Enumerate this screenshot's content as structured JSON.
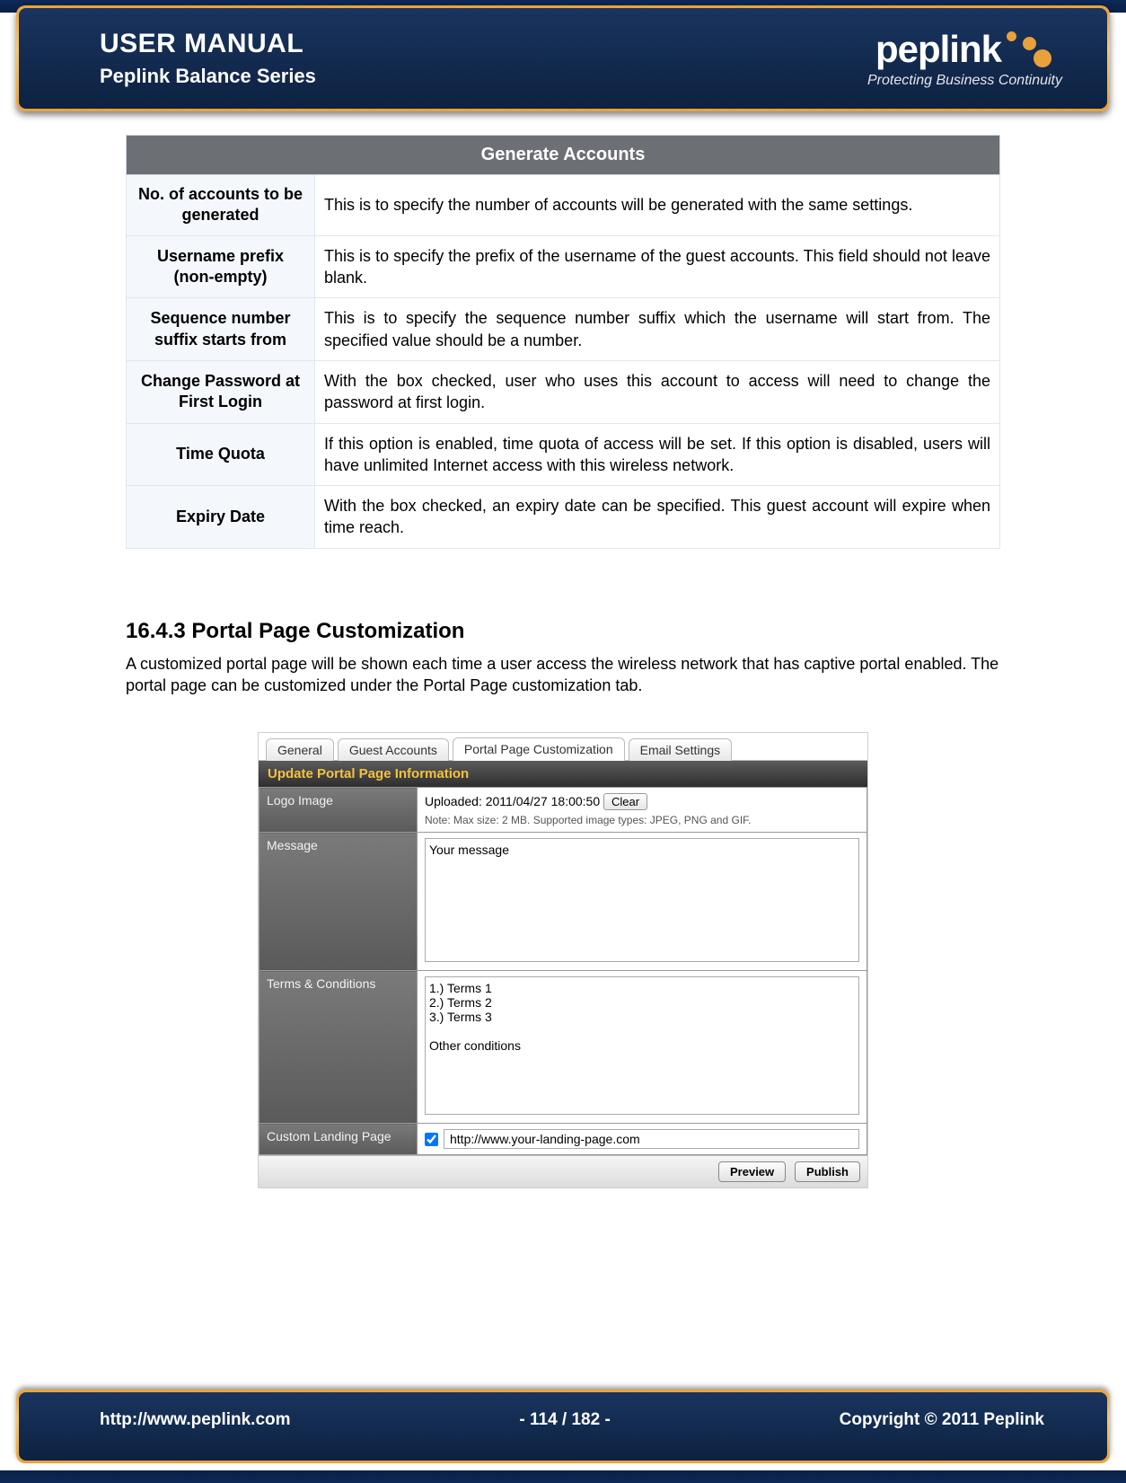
{
  "header": {
    "title": "USER MANUAL",
    "subtitle": "Peplink Balance Series",
    "brand": "peplink",
    "tagline": "Protecting Business Continuity"
  },
  "generate_accounts": {
    "title": "Generate Accounts",
    "rows": [
      {
        "label": "No. of accounts to be generated",
        "desc": "This is to specify the number of accounts will be generated with the same settings."
      },
      {
        "label": "Username prefix (non-empty)",
        "desc": "This is to specify the prefix of the username of the guest accounts. This field should not leave blank."
      },
      {
        "label": "Sequence number suffix starts from",
        "desc": "This is to specify the sequence number suffix which the username will start from. The specified value should be a number."
      },
      {
        "label": "Change Password at First Login",
        "desc": "With the box checked, user who uses this account to access will need to change the password at first login."
      },
      {
        "label": "Time Quota",
        "desc": "If this option is enabled, time quota of access will be set. If this option is disabled, users will have unlimited Internet access with this wireless network."
      },
      {
        "label": "Expiry Date",
        "desc": "With the box checked, an expiry date can be specified. This guest account will expire when time reach."
      }
    ]
  },
  "section": {
    "heading": "16.4.3 Portal Page Customization",
    "para": "A customized portal page will be shown each time a user access the wireless network that has captive portal enabled. The portal page can be customized under the Portal Page customization tab."
  },
  "screenshot": {
    "tabs": [
      "General",
      "Guest Accounts",
      "Portal Page Customization",
      "Email Settings"
    ],
    "active_tab_index": 2,
    "panel_title": "Update Portal Page Information",
    "logo_label": "Logo Image",
    "logo_value": "Uploaded: 2011/04/27 18:00:50",
    "logo_clear": "Clear",
    "logo_note": "Note: Max size: 2 MB. Supported image types: JPEG, PNG and GIF.",
    "message_label": "Message",
    "message_value": "Your message",
    "terms_label": "Terms & Conditions",
    "terms_value": "1.) Terms 1\n2.) Terms 2\n3.) Terms 3\n\nOther conditions",
    "landing_label": "Custom Landing Page",
    "landing_value": "http://www.your-landing-page.com",
    "preview_btn": "Preview",
    "publish_btn": "Publish"
  },
  "footer": {
    "url": "http://www.peplink.com",
    "page": "- 114 / 182 -",
    "copyright": "Copyright © 2011 Peplink"
  }
}
